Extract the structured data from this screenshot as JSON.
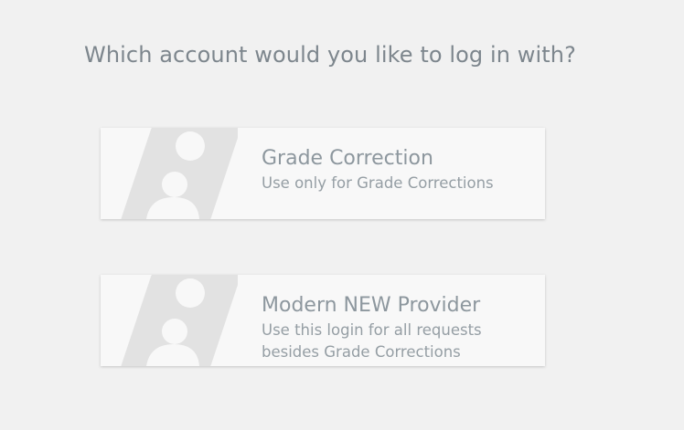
{
  "prompt": {
    "heading": "Which account would you like to log in with?"
  },
  "accounts": [
    {
      "title": "Grade Correction",
      "description": "Use only for Grade Corrections",
      "icon": "user-badge-icon"
    },
    {
      "title": "Modern NEW Provider",
      "description": "Use this login for all requests besides Grade Corrections",
      "icon": "user-badge-icon"
    }
  ],
  "colors": {
    "background": "#f1f1f1",
    "card": "#f8f8f8",
    "icon": "#e2e2e2",
    "text": "#8d979e"
  }
}
